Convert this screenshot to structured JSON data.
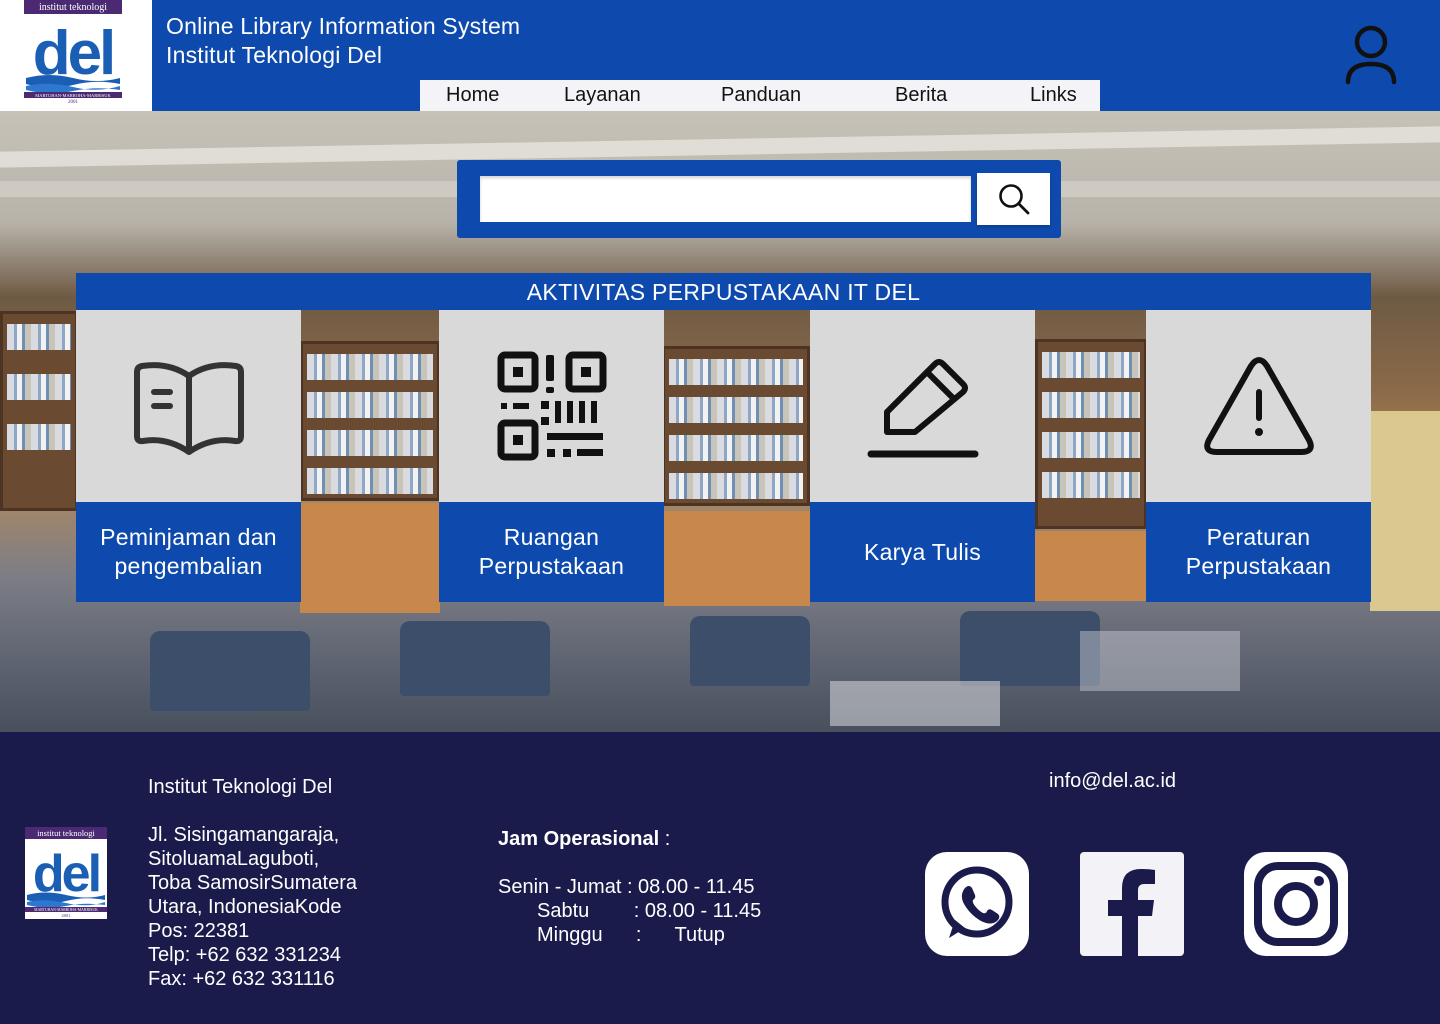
{
  "header": {
    "title_line1": "Online Library Information System",
    "title_line2": "Institut Teknologi Del",
    "logo_top_text": "institut teknologi",
    "logo_word": "del",
    "logo_motto": "MARTUHAN-MARROHA-MARBISUK",
    "logo_year": "2001"
  },
  "nav": {
    "items": [
      {
        "label": "Home"
      },
      {
        "label": "Layanan"
      },
      {
        "label": "Panduan"
      },
      {
        "label": "Berita"
      },
      {
        "label": "Links"
      }
    ]
  },
  "search": {
    "placeholder": "",
    "value": ""
  },
  "section": {
    "title": "AKTIVITAS PERPUSTAKAAN IT DEL"
  },
  "cards": [
    {
      "label": "Peminjaman dan pengembalian",
      "icon": "open-book-icon"
    },
    {
      "label": "Ruangan Perpustakaan",
      "icon": "qr-code-icon"
    },
    {
      "label": "Karya Tulis",
      "icon": "pencil-edit-icon"
    },
    {
      "label": "Peraturan Perpustakaan",
      "icon": "warning-icon"
    }
  ],
  "footer": {
    "org_name": "Institut Teknologi Del",
    "address_lines": [
      "Jl. Sisingamangaraja,",
      "SitoluamaLaguboti,",
      "Toba SamosirSumatera",
      "Utara, IndonesiaKode",
      "Pos: 22381",
      "Telp: +62 632 331234",
      "Fax: +62 632 331116"
    ],
    "hours_title": "Jam Operasional",
    "hours_colon": " :",
    "hours": [
      "Senin - Jumat : 08.00 - 11.45",
      "Sabtu        : 08.00 - 11.45",
      "Minggu      :      Tutup"
    ],
    "email": "info@del.ac.id",
    "social": [
      "whatsapp-icon",
      "facebook-icon",
      "instagram-icon"
    ]
  },
  "colors": {
    "primary_blue": "#0e4aad",
    "footer_navy": "#1b1b4b",
    "card_grey": "#d9d9d9",
    "logo_purple": "#4b2a73"
  }
}
